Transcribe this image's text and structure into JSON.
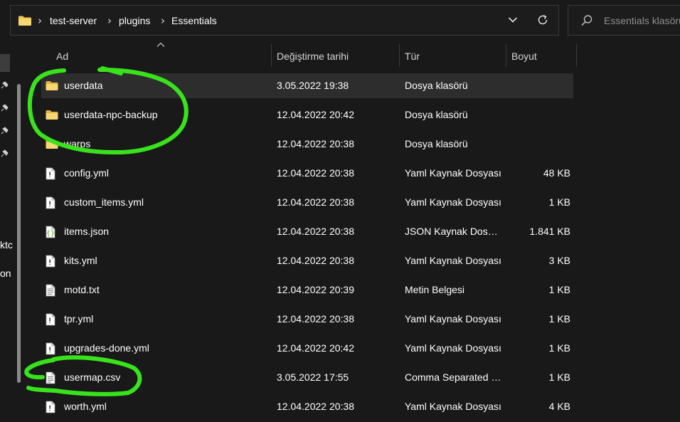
{
  "address": {
    "path": [
      "test-server",
      "plugins",
      "Essentials"
    ],
    "folder_icon": "folder-icon",
    "dropdown_icon": "chevron-down-icon",
    "refresh_icon": "refresh-icon"
  },
  "search": {
    "placeholder": "Essentials klasörü"
  },
  "navpane": {
    "partial_labels": [
      "ktc",
      "on"
    ]
  },
  "columns": {
    "name": "Ad",
    "date": "Değiştirme tarihi",
    "type": "Tür",
    "size": "Boyut"
  },
  "files": [
    {
      "name": "userdata",
      "date": "3.05.2022 19:38",
      "type": "Dosya klasörü",
      "size": "",
      "icon": "folder-icon",
      "selected": true
    },
    {
      "name": "userdata-npc-backup",
      "date": "12.04.2022 20:42",
      "type": "Dosya klasörü",
      "size": "",
      "icon": "folder-icon"
    },
    {
      "name": "warps",
      "date": "12.04.2022 20:38",
      "type": "Dosya klasörü",
      "size": "",
      "icon": "folder-icon"
    },
    {
      "name": "config.yml",
      "date": "12.04.2022 20:38",
      "type": "Yaml Kaynak Dosyası",
      "size": "48 KB",
      "icon": "yaml-file-icon"
    },
    {
      "name": "custom_items.yml",
      "date": "12.04.2022 20:38",
      "type": "Yaml Kaynak Dosyası",
      "size": "1 KB",
      "icon": "yaml-file-icon"
    },
    {
      "name": "items.json",
      "date": "12.04.2022 20:38",
      "type": "JSON Kaynak Dosyası",
      "size": "1.841 KB",
      "icon": "json-file-icon"
    },
    {
      "name": "kits.yml",
      "date": "12.04.2022 20:38",
      "type": "Yaml Kaynak Dosyası",
      "size": "3 KB",
      "icon": "yaml-file-icon"
    },
    {
      "name": "motd.txt",
      "date": "12.04.2022 20:39",
      "type": "Metin Belgesi",
      "size": "1 KB",
      "icon": "text-file-icon"
    },
    {
      "name": "tpr.yml",
      "date": "12.04.2022 20:38",
      "type": "Yaml Kaynak Dosyası",
      "size": "1 KB",
      "icon": "yaml-file-icon"
    },
    {
      "name": "upgrades-done.yml",
      "date": "12.04.2022 20:42",
      "type": "Yaml Kaynak Dosyası",
      "size": "1 KB",
      "icon": "yaml-file-icon"
    },
    {
      "name": "usermap.csv",
      "date": "3.05.2022 17:55",
      "type": "Comma Separated Values",
      "size": "1 KB",
      "icon": "csv-file-icon"
    },
    {
      "name": "worth.yml",
      "date": "12.04.2022 20:38",
      "type": "Yaml Kaynak Dosyası",
      "size": "4 KB",
      "icon": "yaml-file-icon"
    }
  ],
  "colors": {
    "background": "#191919",
    "selected_row": "#2d2d2d",
    "folder": "#f2c94c",
    "annotation": "#39e31c"
  }
}
